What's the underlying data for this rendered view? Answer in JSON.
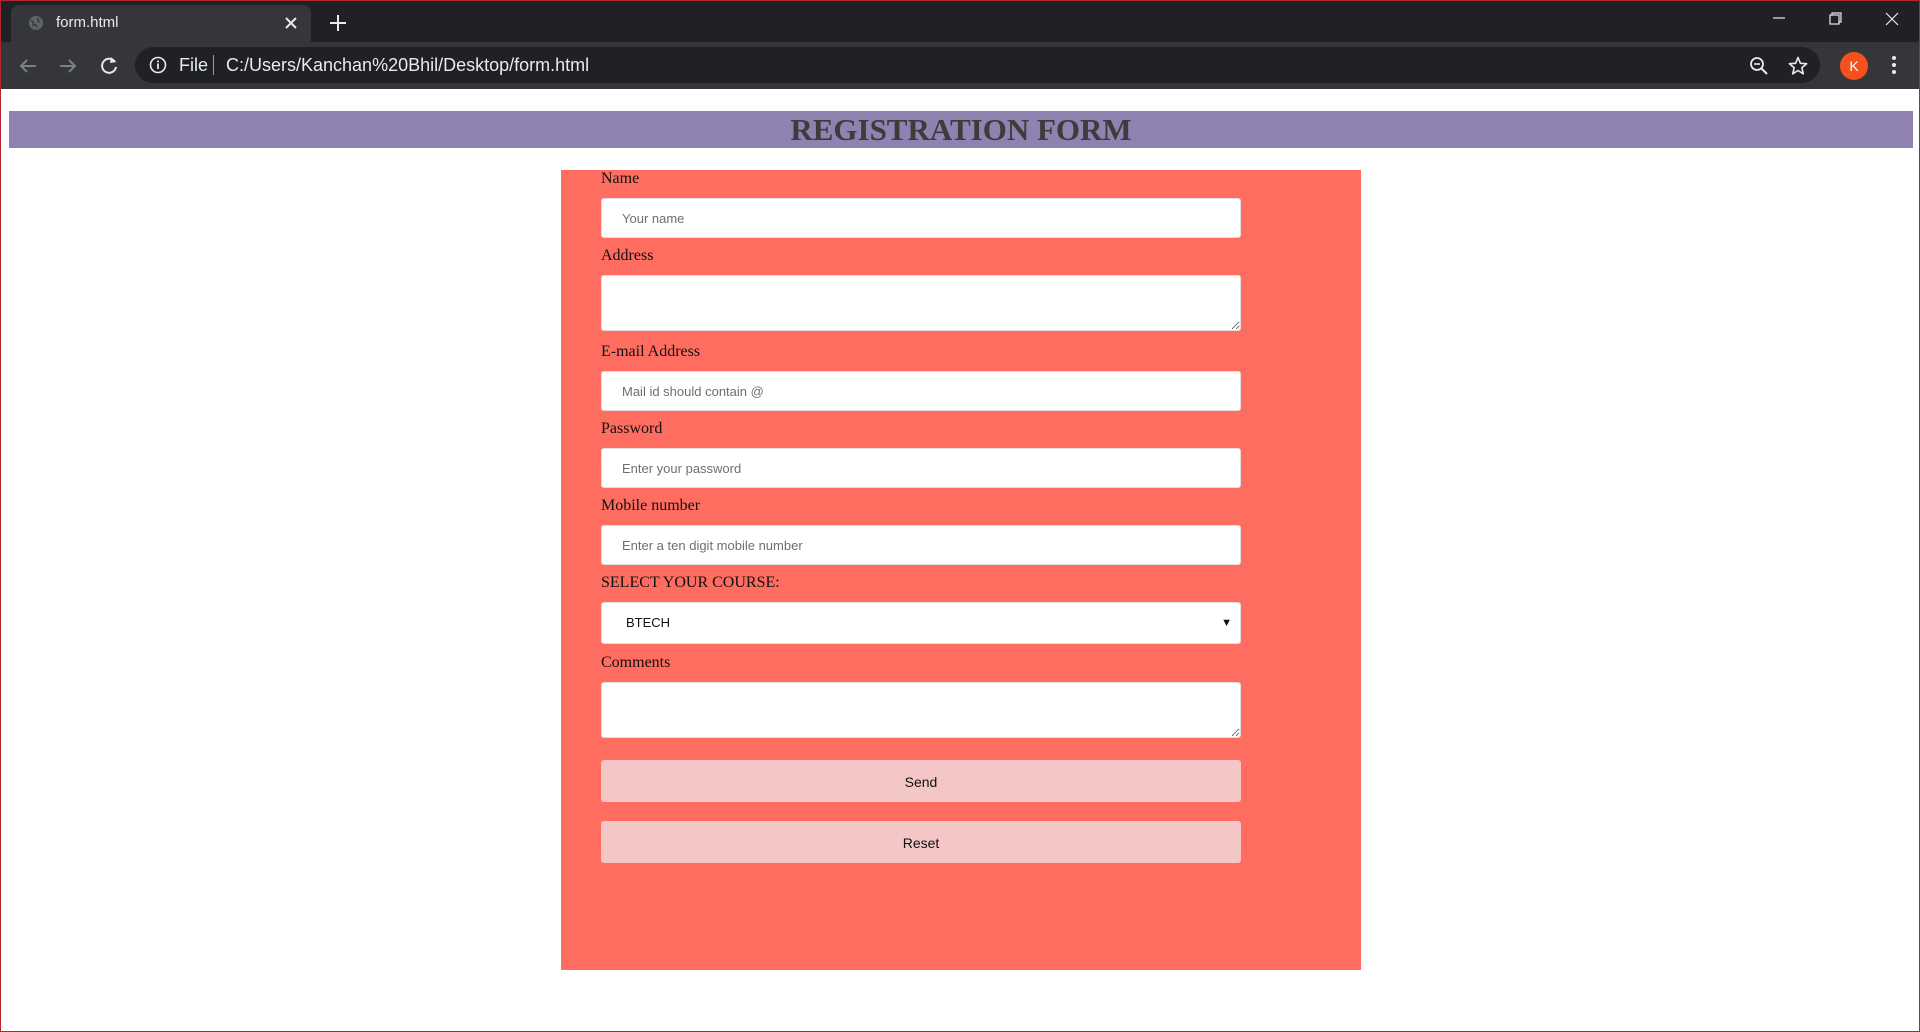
{
  "browser": {
    "tab_title": "form.html",
    "omnibox_scheme_label": "File",
    "url": "C:/Users/Kanchan%20Bhil/Desktop/form.html",
    "profile_initial": "K",
    "profile_color": "#f4511e"
  },
  "page": {
    "heading": "REGISTRATION FORM",
    "header_color": "#8f82b0",
    "panel_color": "#ff6d60"
  },
  "form": {
    "name": {
      "label": "Name",
      "placeholder": "Your name"
    },
    "address": {
      "label": "Address"
    },
    "email": {
      "label": "E-mail Address",
      "placeholder": "Mail id should contain @"
    },
    "password": {
      "label": "Password",
      "placeholder": "Enter your password"
    },
    "mobile": {
      "label": "Mobile number",
      "placeholder": "Enter a ten digit mobile number"
    },
    "course": {
      "label": "SELECT YOUR COURSE:",
      "selected": "BTECH"
    },
    "comments": {
      "label": "Comments"
    },
    "send_label": "Send",
    "reset_label": "Reset",
    "button_color": "#f5c6c6"
  }
}
